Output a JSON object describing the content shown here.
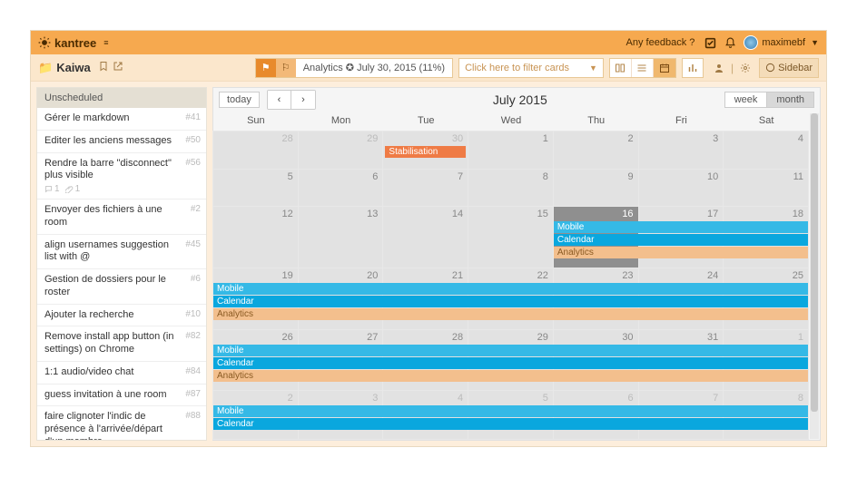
{
  "topbar": {
    "brand": "kantree",
    "feedback": "Any feedback ?",
    "username": "maximebf"
  },
  "project": {
    "name": "Kaiwa",
    "breadcrumb_text": "Analytics ✪ July 30, 2015 (11%)",
    "filter_placeholder": "Click here to filter cards",
    "sidebar_label": "Sidebar"
  },
  "unscheduled": {
    "title": "Unscheduled",
    "cards": [
      {
        "title": "Gérer le markdown",
        "id": "#41"
      },
      {
        "title": "Editer les anciens messages",
        "id": "#50"
      },
      {
        "title": "Rendre la barre \"disconnect\" plus visible",
        "id": "#56",
        "comments": "1",
        "attachments": "1"
      },
      {
        "title": "Envoyer des fichiers à une room",
        "id": "#2"
      },
      {
        "title": "align usernames suggestion list with @",
        "id": "#45"
      },
      {
        "title": "Gestion de dossiers pour le roster",
        "id": "#6"
      },
      {
        "title": "Ajouter la recherche",
        "id": "#10"
      },
      {
        "title": "Remove install app button (in settings) on Chrome",
        "id": "#82"
      },
      {
        "title": "1:1 audio/video chat",
        "id": "#84"
      },
      {
        "title": "guess invitation à une room",
        "id": "#87"
      },
      {
        "title": "faire clignoter l'indic de présence à l'arrivée/départ d'un membre",
        "id": "#88"
      }
    ]
  },
  "calendar": {
    "today_label": "today",
    "prev": "‹",
    "next": "›",
    "title": "July 2015",
    "range": {
      "week": "week",
      "month": "month",
      "active": "month"
    },
    "day_headers": [
      "Sun",
      "Mon",
      "Tue",
      "Wed",
      "Thu",
      "Fri",
      "Sat"
    ],
    "events": {
      "stabilisation": "Stabilisation",
      "mobile": "Mobile",
      "calendar": "Calendar",
      "analytics": "Analytics"
    },
    "weeks": [
      [
        {
          "n": "28",
          "out": true
        },
        {
          "n": "29",
          "out": true
        },
        {
          "n": "30",
          "out": true,
          "ev": [
            {
              "k": "stab",
              "label": "stabilisation",
              "short": true
            }
          ]
        },
        {
          "n": "1"
        },
        {
          "n": "2"
        },
        {
          "n": "3"
        },
        {
          "n": "4"
        }
      ],
      [
        {
          "n": "5"
        },
        {
          "n": "6"
        },
        {
          "n": "7"
        },
        {
          "n": "8"
        },
        {
          "n": "9"
        },
        {
          "n": "10"
        },
        {
          "n": "11"
        }
      ],
      [
        {
          "n": "12"
        },
        {
          "n": "13"
        },
        {
          "n": "14"
        },
        {
          "n": "15"
        },
        {
          "n": "16",
          "today": true,
          "ev": [
            {
              "k": "mobile",
              "label": "mobile",
              "span": 3
            },
            {
              "k": "calendar",
              "label": "calendar",
              "span": 3
            },
            {
              "k": "analytics",
              "label": "analytics",
              "span": 3
            }
          ]
        },
        {
          "n": "17",
          "skip_ev": 3
        },
        {
          "n": "18",
          "skip_ev": 3
        }
      ],
      [
        {
          "n": "19",
          "ev": [
            {
              "k": "mobile",
              "label": "mobile",
              "span": 7
            },
            {
              "k": "calendar",
              "label": "calendar",
              "span": 7
            },
            {
              "k": "analytics",
              "label": "analytics",
              "span": 7
            }
          ]
        },
        {
          "n": "20",
          "skip_ev": 3
        },
        {
          "n": "21",
          "skip_ev": 3
        },
        {
          "n": "22",
          "skip_ev": 3
        },
        {
          "n": "23",
          "skip_ev": 3
        },
        {
          "n": "24",
          "skip_ev": 3
        },
        {
          "n": "25",
          "skip_ev": 3
        }
      ],
      [
        {
          "n": "26",
          "ev": [
            {
              "k": "mobile",
              "label": "mobile",
              "span": 7
            },
            {
              "k": "calendar",
              "label": "calendar",
              "span": 7
            },
            {
              "k": "analytics",
              "label": "analytics",
              "span": 7
            }
          ]
        },
        {
          "n": "27",
          "skip_ev": 3
        },
        {
          "n": "28",
          "skip_ev": 3
        },
        {
          "n": "29",
          "skip_ev": 3
        },
        {
          "n": "30",
          "skip_ev": 3
        },
        {
          "n": "31",
          "skip_ev": 3
        },
        {
          "n": "1",
          "out": true,
          "skip_ev": 3
        }
      ],
      [
        {
          "n": "2",
          "out": true,
          "ev": [
            {
              "k": "mobile",
              "label": "mobile",
              "span": 7
            },
            {
              "k": "calendar",
              "label": "calendar",
              "span": 7
            }
          ]
        },
        {
          "n": "3",
          "out": true,
          "skip_ev": 2
        },
        {
          "n": "4",
          "out": true,
          "skip_ev": 2
        },
        {
          "n": "5",
          "out": true,
          "skip_ev": 2
        },
        {
          "n": "6",
          "out": true,
          "skip_ev": 2
        },
        {
          "n": "7",
          "out": true,
          "skip_ev": 2
        },
        {
          "n": "8",
          "out": true,
          "skip_ev": 2
        }
      ]
    ]
  }
}
